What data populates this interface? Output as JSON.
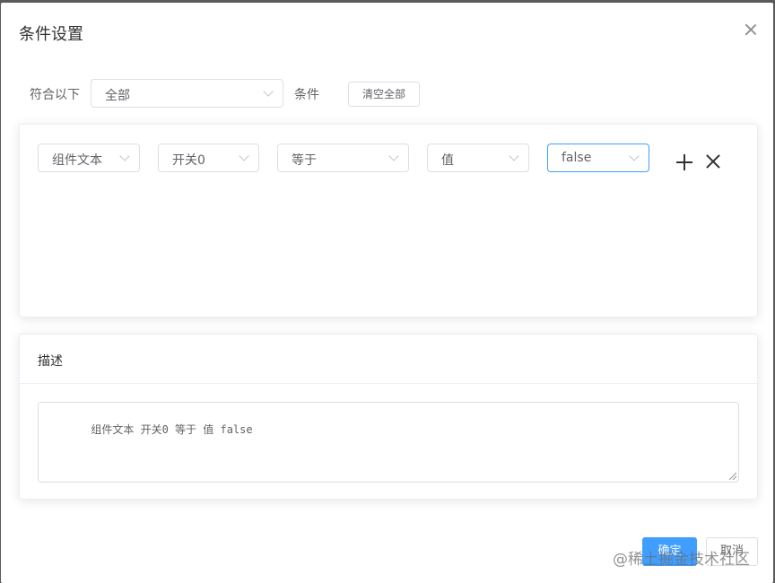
{
  "dialog": {
    "title": "条件设置"
  },
  "match_row": {
    "prefix_label": "符合以下",
    "match_select_value": "全部",
    "suffix_label": "条件",
    "clear_all_label": "清空全部"
  },
  "condition": {
    "component": "组件文本",
    "field": "开关0",
    "operator": "等于",
    "value_type": "值",
    "value": "false"
  },
  "description": {
    "title": "描述",
    "text": "组件文本 开关0 等于 值 false"
  },
  "footer": {
    "confirm_label": "确定",
    "cancel_label": "取消"
  },
  "watermark": "@稀土掘金技术社区",
  "colors": {
    "primary": "#409eff",
    "border": "#dcdfe6",
    "text": "#606266"
  },
  "icons": [
    "close-icon",
    "chevron-down-icon",
    "plus-icon",
    "remove-icon"
  ]
}
